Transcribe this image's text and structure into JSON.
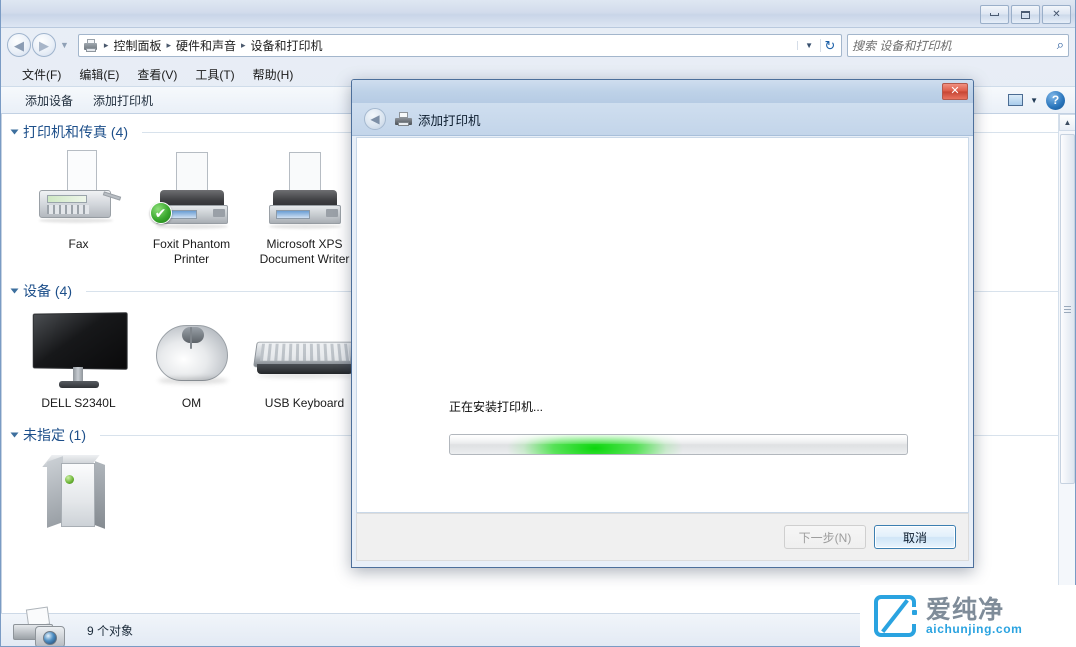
{
  "window": {
    "controls": {
      "minimize": "–",
      "maximize": "□",
      "close": "✕"
    },
    "address": {
      "breadcrumb": [
        "控制面板",
        "硬件和声音",
        "设备和打印机"
      ],
      "separator": "▸",
      "dropdown_glyph": "▼",
      "refresh_glyph": "↻"
    },
    "nav": {
      "back_glyph": "◀",
      "forward_glyph": "▶",
      "recent_glyph": "▼"
    },
    "search": {
      "placeholder": "搜索 设备和打印机",
      "icon_glyph": "⌕"
    },
    "menubar": [
      "文件(F)",
      "编辑(E)",
      "查看(V)",
      "工具(T)",
      "帮助(H)"
    ],
    "commandbar": {
      "items": [
        "添加设备",
        "添加打印机"
      ],
      "view_chevron": "▼",
      "help_glyph": "?"
    },
    "statusbar": {
      "text": "9 个对象"
    },
    "scrollbar": {
      "up_glyph": "▲",
      "down_glyph": "▼"
    }
  },
  "groups": [
    {
      "title": "打印机和传真 (4)",
      "items": [
        {
          "label": "Fax",
          "icon": "fax-icon",
          "default": false
        },
        {
          "label": "Foxit Phantom Printer",
          "icon": "printer-icon",
          "default": true,
          "badge": "✔"
        },
        {
          "label": "Microsoft XPS Document Writer",
          "icon": "printer-icon",
          "default": false
        }
      ]
    },
    {
      "title": "设备 (4)",
      "items": [
        {
          "label": "DELL S2340L",
          "icon": "monitor-icon"
        },
        {
          "label": "OM",
          "icon": "mouse-icon"
        },
        {
          "label": "USB Keyboard",
          "icon": "keyboard-icon"
        }
      ]
    },
    {
      "title": "未指定 (1)",
      "items": [
        {
          "label": "",
          "icon": "computer-tower-icon"
        }
      ]
    }
  ],
  "dialog": {
    "title": "添加打印机",
    "back_glyph": "◀",
    "close_label": "✕",
    "status_text": "正在安装打印机...",
    "progress": {
      "mode": "marquee",
      "color": "#00d600",
      "track_color": "#e2e4e6"
    },
    "buttons": {
      "next": {
        "label": "下一步(N)",
        "enabled": false
      },
      "cancel": {
        "label": "取消",
        "enabled": true,
        "default": true
      }
    }
  },
  "watermark": {
    "cn": "爱纯净",
    "en": "aichunjing.com",
    "color": "#2aa3e0"
  }
}
